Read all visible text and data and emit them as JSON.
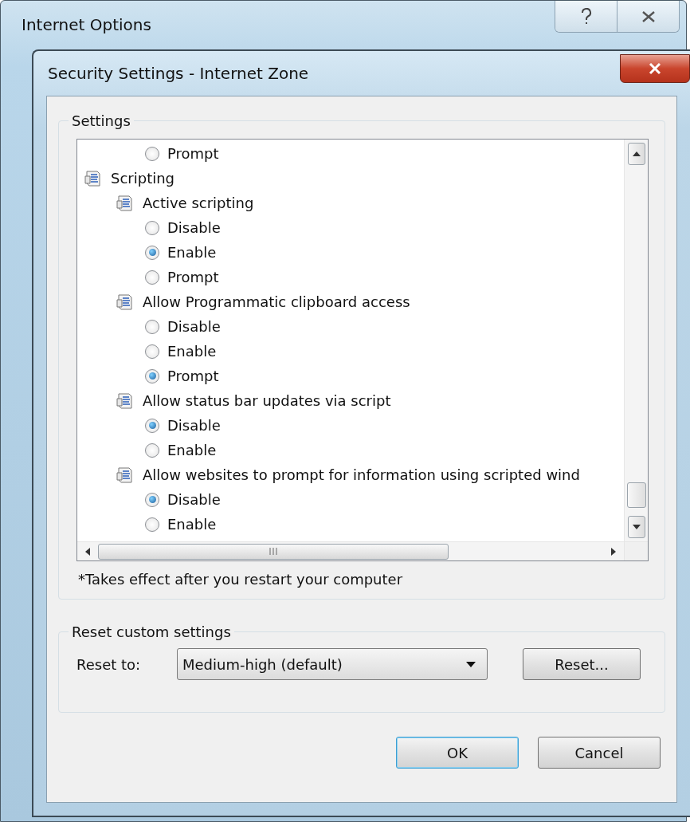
{
  "parent_window": {
    "title": "Internet Options"
  },
  "dialog": {
    "title": "Security Settings - Internet Zone",
    "settings_group": {
      "label": "Settings",
      "tree": [
        {
          "kind": "setting",
          "children": [
            {
              "kind": "setting",
              "children": [
                {
                  "kind": "option",
                  "label": "Prompt",
                  "selected": false
                }
              ]
            }
          ]
        },
        {
          "kind": "setting",
          "label": "Scripting",
          "children": [
            {
              "kind": "setting",
              "label": "Active scripting",
              "children": [
                {
                  "kind": "option",
                  "label": "Disable",
                  "selected": false
                },
                {
                  "kind": "option",
                  "label": "Enable",
                  "selected": true
                },
                {
                  "kind": "option",
                  "label": "Prompt",
                  "selected": false
                }
              ]
            },
            {
              "kind": "setting",
              "label": "Allow Programmatic clipboard access",
              "children": [
                {
                  "kind": "option",
                  "label": "Disable",
                  "selected": false
                },
                {
                  "kind": "option",
                  "label": "Enable",
                  "selected": false
                },
                {
                  "kind": "option",
                  "label": "Prompt",
                  "selected": true
                }
              ]
            },
            {
              "kind": "setting",
              "label": "Allow status bar updates via script",
              "children": [
                {
                  "kind": "option",
                  "label": "Disable",
                  "selected": true
                },
                {
                  "kind": "option",
                  "label": "Enable",
                  "selected": false
                }
              ]
            },
            {
              "kind": "setting",
              "label": "Allow websites to prompt for information using scripted wind",
              "children": [
                {
                  "kind": "option",
                  "label": "Disable",
                  "selected": true
                },
                {
                  "kind": "option",
                  "label": "Enable",
                  "selected": false
                }
              ]
            }
          ]
        }
      ]
    },
    "footnote": "*Takes effect after you restart your computer",
    "reset_group": {
      "label": "Reset custom settings",
      "reset_to_label": "Reset to:",
      "dropdown_value": "Medium-high (default)",
      "reset_button": "Reset..."
    },
    "buttons": [
      {
        "label": "OK",
        "default": true
      },
      {
        "label": "Cancel",
        "default": false
      }
    ]
  }
}
